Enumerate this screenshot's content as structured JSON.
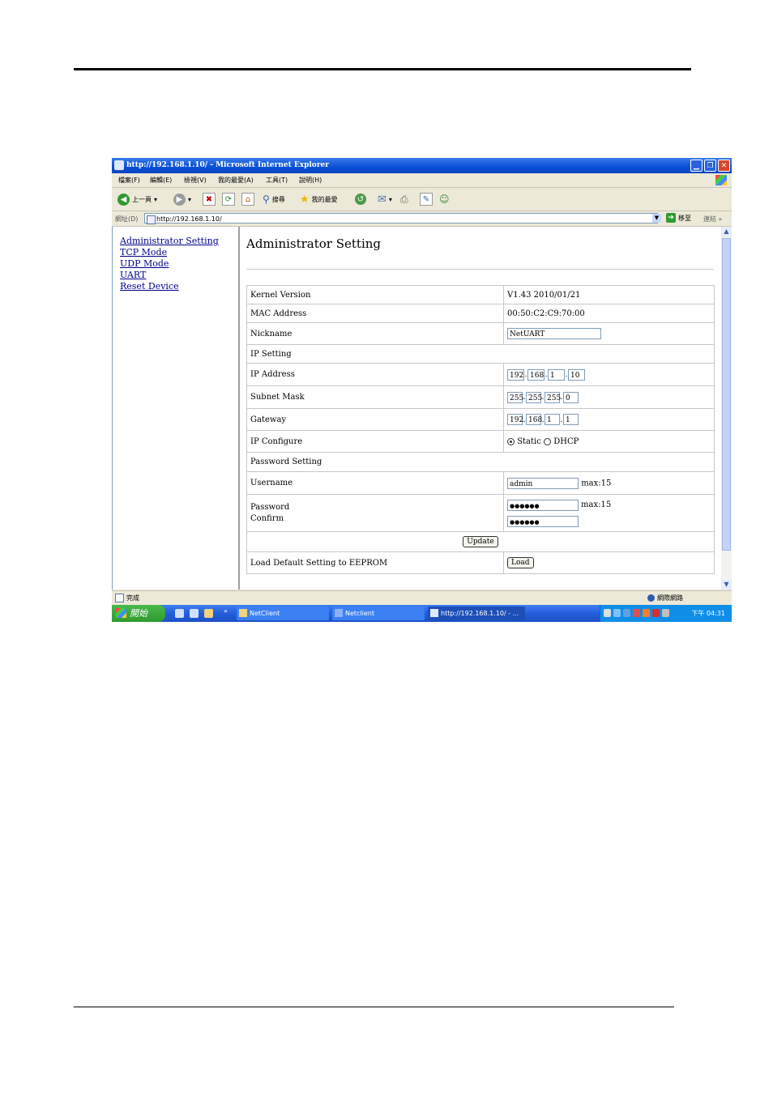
{
  "browser": {
    "title": "http://192.168.1.10/ - Microsoft Internet Explorer",
    "menu": [
      "檔案(F)",
      "編輯(E)",
      "檢視(V)",
      "我的最愛(A)",
      "工具(T)",
      "說明(H)"
    ],
    "toolbar": {
      "back_label": "上一頁",
      "search_label": "搜尋",
      "favorites_label": "我的最愛"
    },
    "address": {
      "label": "網址(D)",
      "url": "http://192.168.1.10/",
      "go_label": "移至",
      "links_label": "連結"
    },
    "status": {
      "left": "完成",
      "zone": "網際網路"
    }
  },
  "nav": [
    "Administrator Setting",
    "TCP Mode",
    "UDP Mode",
    "UART",
    "Reset Device"
  ],
  "page": {
    "title": "Administrator Setting",
    "kernel_label": "Kernel Version",
    "kernel_value": "V1.43 2010/01/21",
    "mac_label": "MAC Address",
    "mac_value": "00:50:C2:C9:70:00",
    "nickname_label": "Nickname",
    "nickname_value": "NetUART",
    "ip_setting_header": "IP Setting",
    "ip_label": "IP Address",
    "ip_octets": [
      "192",
      "168",
      "1",
      "10"
    ],
    "mask_label": "Subnet Mask",
    "mask_octets": [
      "255",
      "255",
      "255",
      "0"
    ],
    "gateway_label": "Gateway",
    "gateway_octets": [
      "192",
      "168",
      "1",
      "1"
    ],
    "ipconfig_label": "IP Configure",
    "static_label": "Static",
    "dhcp_label": "DHCP",
    "ipconfig_selected": "Static",
    "password_setting_header": "Password Setting",
    "username_label": "Username",
    "username_value": "admin",
    "max_note": "max:15",
    "password_label": "Password",
    "confirm_label": "Confirm",
    "password_mask": "●●●●●●",
    "confirm_mask": "●●●●●●",
    "update_button": "Update",
    "load_default_label": "Load Default Setting to EEPROM",
    "load_button": "Load"
  },
  "taskbar": {
    "start_label": "開始",
    "tasks": [
      "NetClient",
      "Netclient",
      "http://192.168.1.10/ - ..."
    ],
    "clock": "下午 04:31"
  }
}
